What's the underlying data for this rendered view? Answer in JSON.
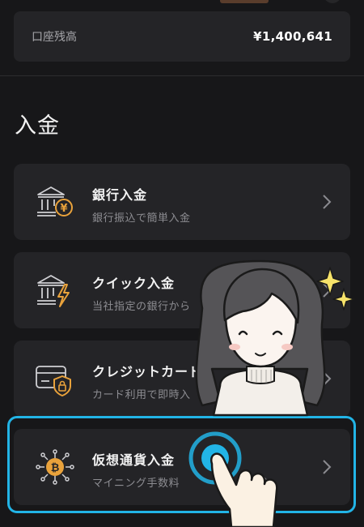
{
  "balance": {
    "label": "口座残高",
    "value": "¥1,400,641"
  },
  "section_title": "入金",
  "methods": [
    {
      "title": "銀行入金",
      "subtitle": "銀行振込で簡単入金",
      "icon": "bank-yen-icon"
    },
    {
      "title": "クイック入金",
      "subtitle": "当社指定の銀行から",
      "icon": "bank-lightning-icon"
    },
    {
      "title": "クレジットカード",
      "subtitle": "カード利用で即時入",
      "icon": "credit-card-lock-icon"
    },
    {
      "title": "仮想通貨入金",
      "subtitle": "マイニング手数料",
      "icon": "bitcoin-network-icon",
      "subtitle_tail": "時入金"
    }
  ],
  "icons": {
    "chevron": "chevron-right-icon",
    "tap": "tap-hand-icon",
    "sparkle": "sparkle-icon"
  },
  "colors": {
    "background": "#171719",
    "card": "#242427",
    "accent_orange": "#e9a23b",
    "highlight": "#22b4e6"
  }
}
